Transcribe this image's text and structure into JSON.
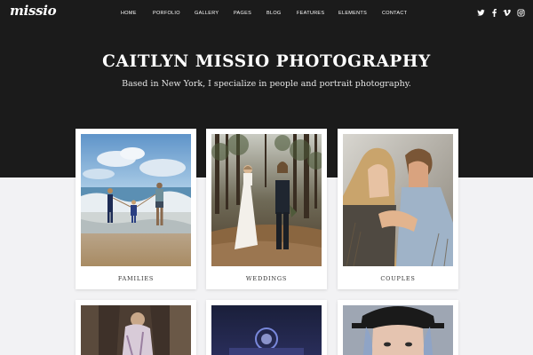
{
  "brand": {
    "logo_text": "missio"
  },
  "nav": {
    "items": [
      "HOME",
      "PORFOLIO",
      "GALLERY",
      "PAGES",
      "BLOG",
      "FEATURES",
      "ELEMENTS",
      "CONTACT"
    ]
  },
  "social": {
    "icons": [
      "twitter-icon",
      "facebook-icon",
      "vimeo-icon",
      "instagram-icon"
    ]
  },
  "hero": {
    "title": "CAITLYN MISSIO PHOTOGRAPHY",
    "subtitle": "Based in New York, I specialize in people and portrait photography."
  },
  "gallery": {
    "cards": [
      {
        "label": "FAMILIES"
      },
      {
        "label": "WEDDINGS"
      },
      {
        "label": "COUPLES"
      }
    ]
  },
  "colors": {
    "hero_bg": "#1b1b1b",
    "page_bg": "#f2f2f4",
    "card_bg": "#ffffff"
  }
}
